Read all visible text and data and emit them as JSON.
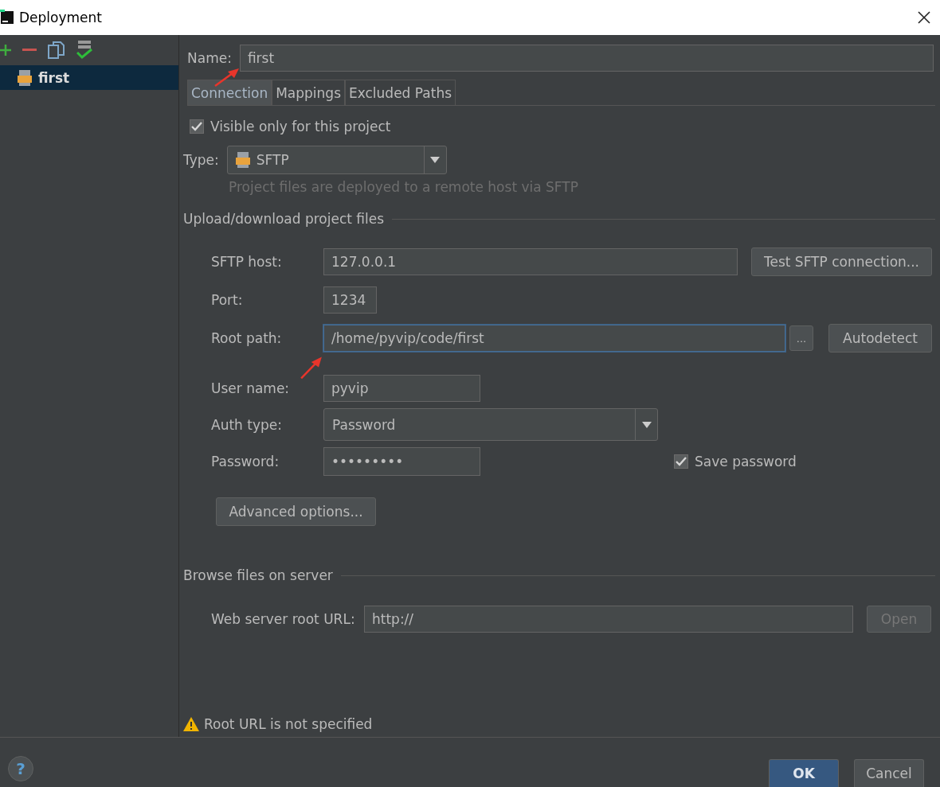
{
  "window": {
    "title": "Deployment"
  },
  "sidebar": {
    "items": [
      {
        "label": "first",
        "selected": true
      }
    ]
  },
  "name": {
    "label": "Name:",
    "value": "first"
  },
  "tabs": [
    {
      "label": "Connection",
      "selected": true
    },
    {
      "label": "Mappings",
      "selected": false
    },
    {
      "label": "Excluded Paths",
      "selected": false
    }
  ],
  "visible_only": {
    "label": "Visible only for this project",
    "checked": true
  },
  "type": {
    "label": "Type:",
    "value": "SFTP",
    "hint": "Project files are deployed to a remote host via SFTP"
  },
  "upload_section": {
    "title": "Upload/download project files",
    "host": {
      "label": "SFTP host:",
      "value": "127.0.0.1",
      "button": "Test SFTP connection..."
    },
    "port": {
      "label": "Port:",
      "value": "1234"
    },
    "root_path": {
      "label": "Root path:",
      "value": "/home/pyvip/code/first",
      "browse_button": "...",
      "button": "Autodetect"
    },
    "user_name": {
      "label": "User name:",
      "value": "pyvip"
    },
    "auth_type": {
      "label": "Auth type:",
      "value": "Password"
    },
    "password": {
      "label": "Password:",
      "value": "•••••••••"
    },
    "save_password": {
      "label": "Save password",
      "checked": true
    },
    "advanced_button": "Advanced options..."
  },
  "browse_section": {
    "title": "Browse files on server",
    "url_label": "Web server root URL:",
    "url_value": "http://",
    "open_button": {
      "label": "Open",
      "disabled": true
    }
  },
  "warning": "Root URL is not specified",
  "help_button": "?",
  "buttons": [
    {
      "label": "OK",
      "kind": "primary"
    },
    {
      "label": "Cancel",
      "kind": "default"
    }
  ]
}
